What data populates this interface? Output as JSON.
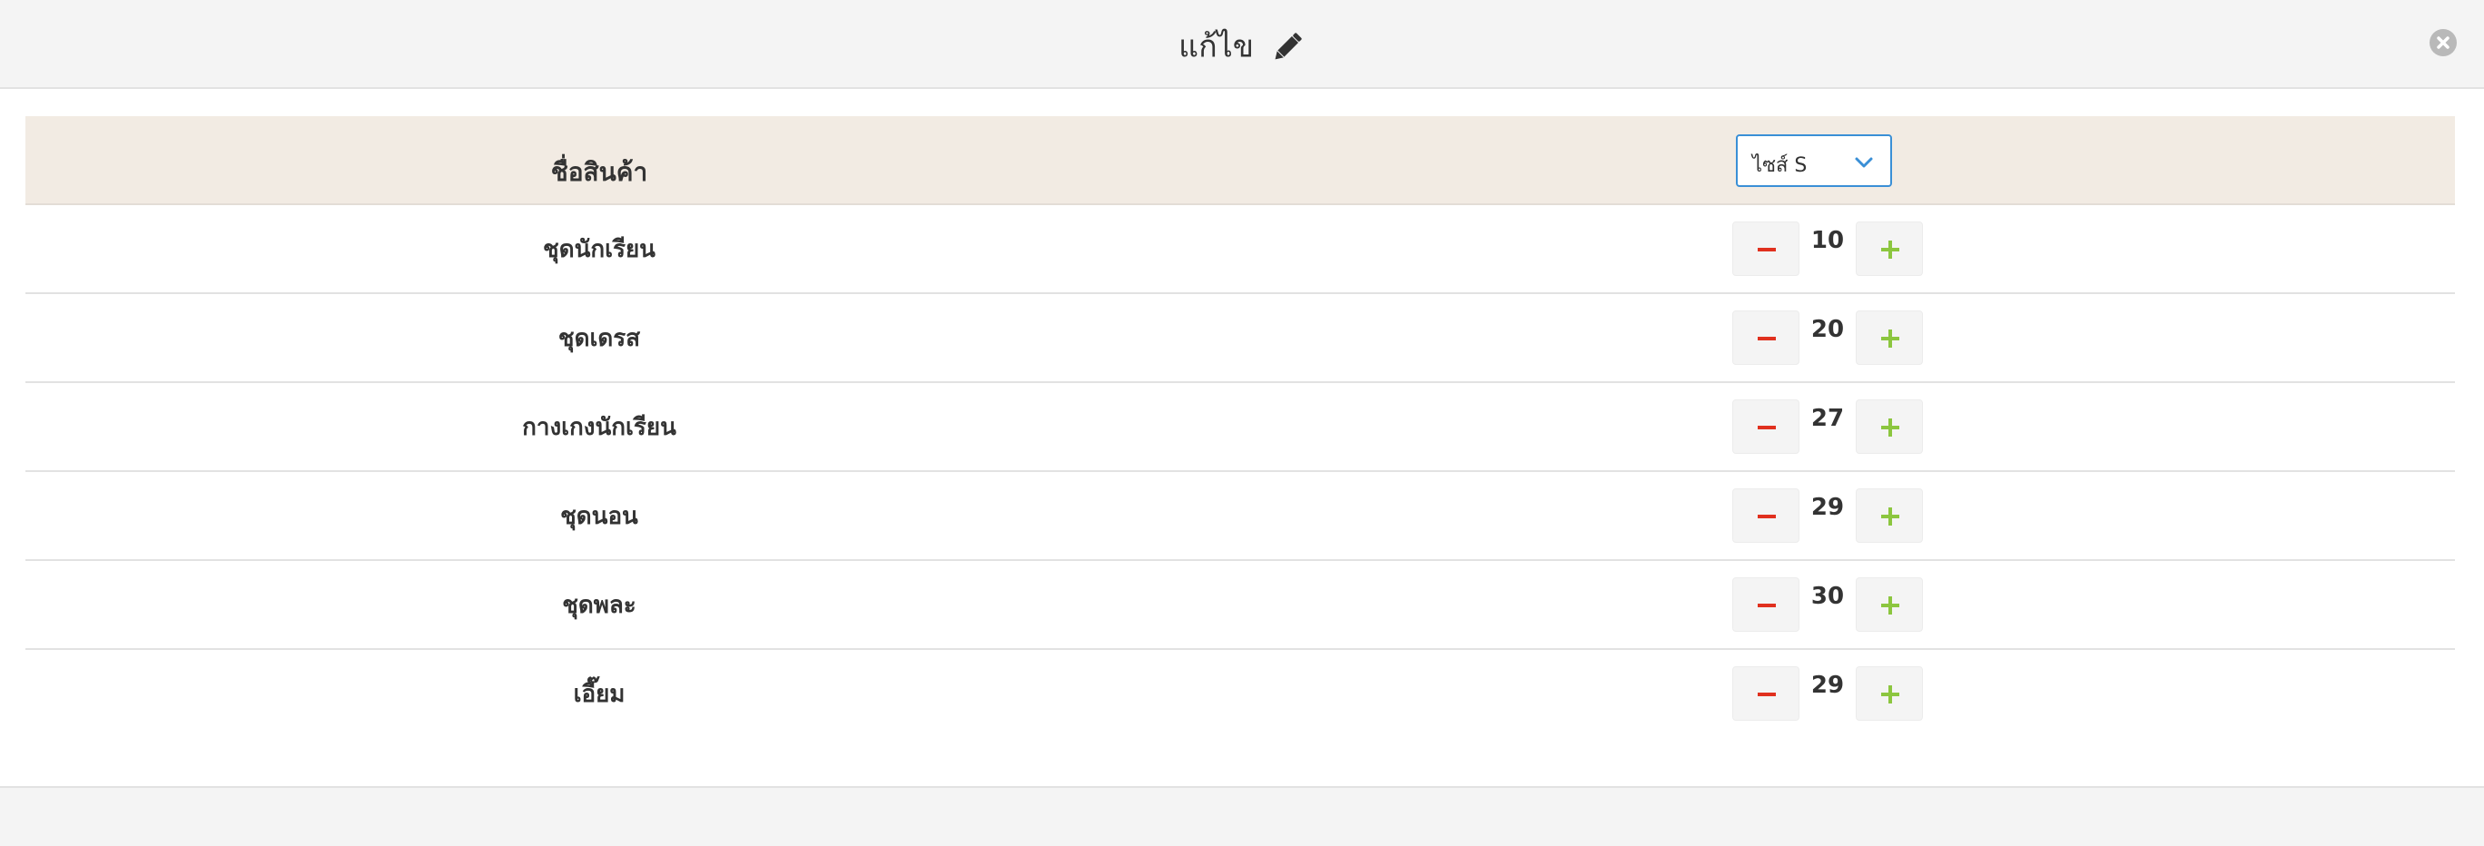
{
  "modal": {
    "title": "แก้ไข",
    "title_icon": "pencil-icon",
    "close_icon": "close-icon"
  },
  "table": {
    "header_name": "ชื่อสินค้า",
    "size_select": {
      "selected": "ไซส์ S",
      "icon": "chevron-down-icon"
    },
    "rows": [
      {
        "name": "ชุดนักเรียน",
        "qty": "10"
      },
      {
        "name": "ชุดเดรส",
        "qty": "20"
      },
      {
        "name": "กางเกงนักเรียน",
        "qty": "27"
      },
      {
        "name": "ชุดนอน",
        "qty": "29"
      },
      {
        "name": "ชุดพละ",
        "qty": "30"
      },
      {
        "name": "เอี๊ยม",
        "qty": "29"
      }
    ]
  },
  "colors": {
    "minus": "#e0301e",
    "plus": "#8cc63f",
    "select_border": "#3a8fd6",
    "header_bg": "#f2ebe3"
  }
}
